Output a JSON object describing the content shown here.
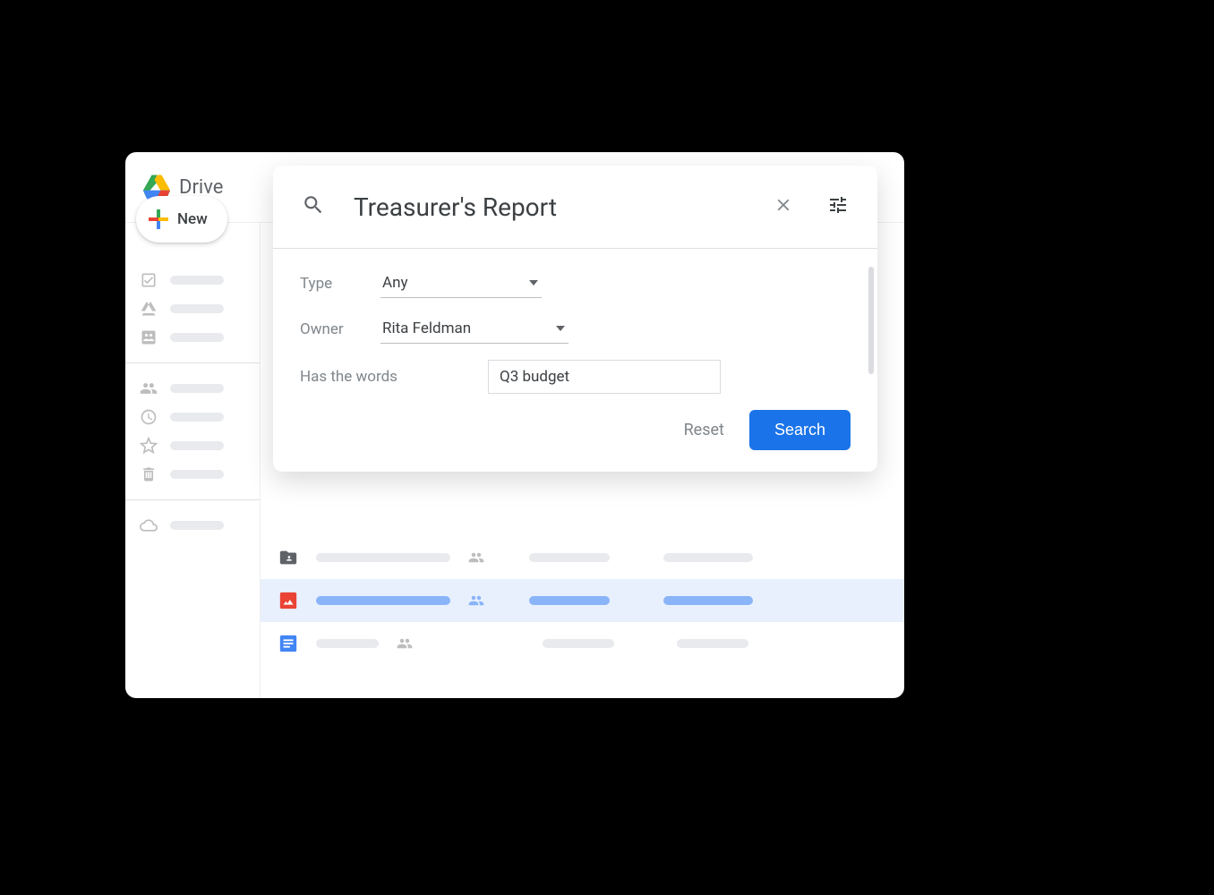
{
  "app": {
    "name": "Drive"
  },
  "sidebar": {
    "new_label": "New"
  },
  "search": {
    "query": "Treasurer's Report",
    "filters": {
      "type_label": "Type",
      "type_value": "Any",
      "owner_label": "Owner",
      "owner_value": "Rita Feldman",
      "words_label": "Has the words",
      "words_value": "Q3 budget"
    },
    "reset_label": "Reset",
    "search_label": "Search"
  }
}
